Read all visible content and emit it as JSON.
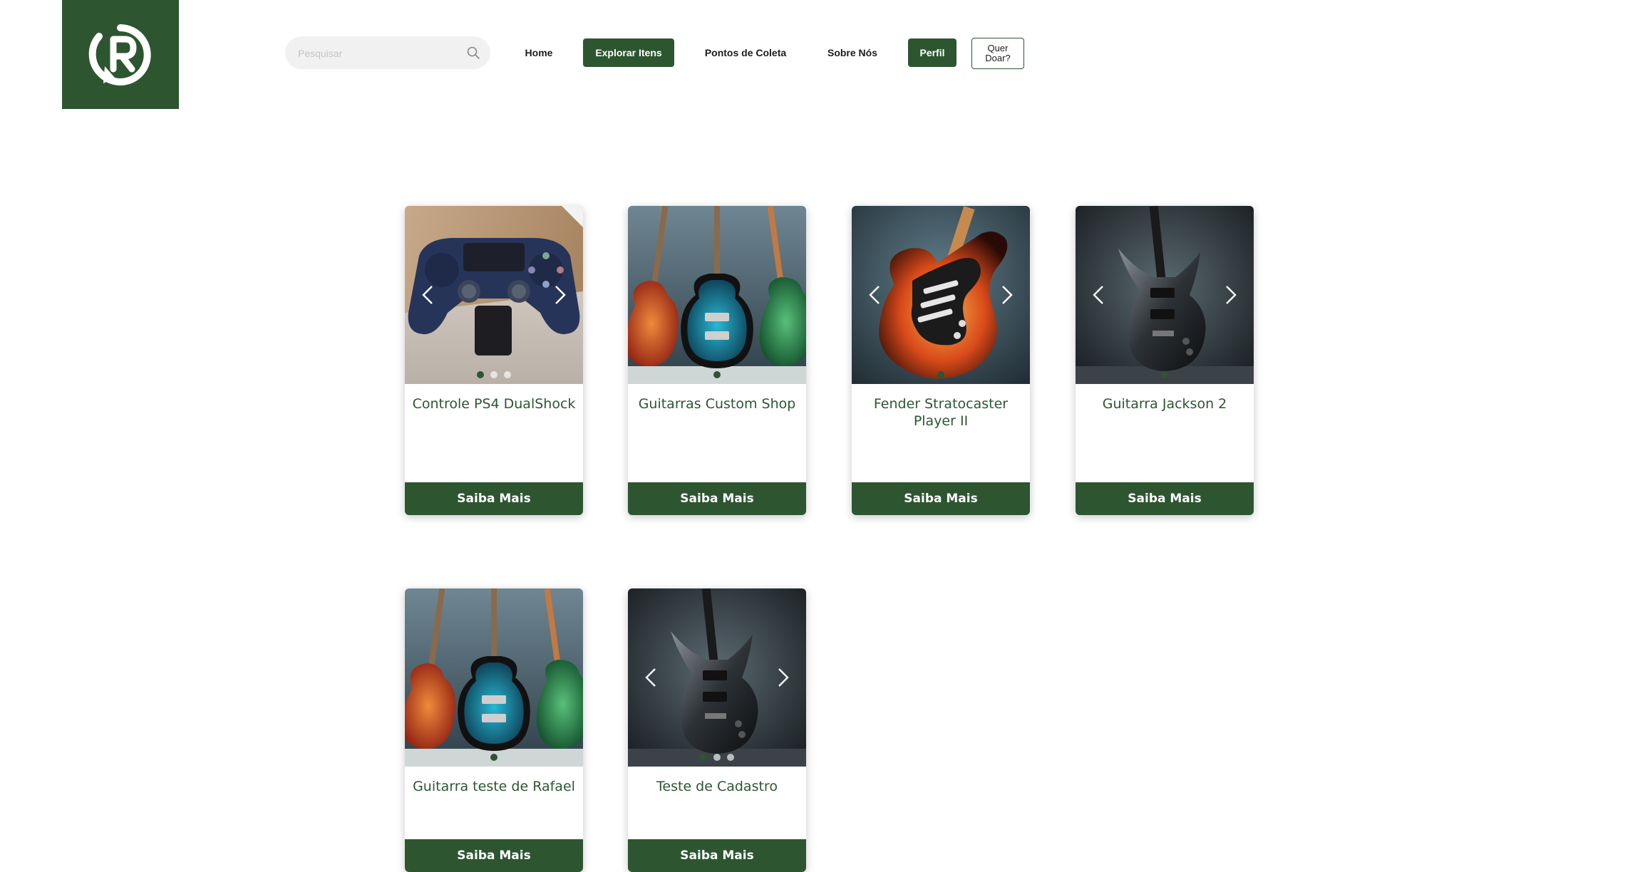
{
  "header": {
    "search": {
      "placeholder": "Pesquisar",
      "value": ""
    },
    "nav": {
      "home": "Home",
      "explore": "Explorar Itens",
      "points": "Pontos de Coleta",
      "about": "Sobre Nós",
      "profile": "Perfil",
      "donate_line1": "Quer",
      "donate_line2": "Doar?"
    }
  },
  "colors": {
    "brand": "#2d5630",
    "brand_text": "#2d5630",
    "search_bg": "#f1f1f1"
  },
  "items": [
    {
      "title": "Controle PS4 DualShock",
      "button": "Saiba Mais",
      "image": "ps4-controller-photo",
      "dots": 3,
      "active_dot": 0,
      "arrows": true
    },
    {
      "title": "Guitarras Custom Shop",
      "button": "Saiba Mais",
      "image": "three-guitars-photo",
      "dots": 1,
      "active_dot": 0,
      "arrows": false
    },
    {
      "title": "Fender Stratocaster Player II",
      "button": "Saiba Mais",
      "image": "sunburst-stratocaster-photo",
      "dots": 1,
      "active_dot": 0,
      "arrows": true
    },
    {
      "title": "Guitarra Jackson 2",
      "button": "Saiba Mais",
      "image": "black-jackson-guitar-photo",
      "dots": 1,
      "active_dot": 0,
      "arrows": true
    },
    {
      "title": "Guitarra teste de Rafael",
      "button": "Saiba Mais",
      "image": "three-guitars-photo",
      "dots": 1,
      "active_dot": 0,
      "arrows": false
    },
    {
      "title": "Teste de Cadastro",
      "button": "Saiba Mais",
      "image": "black-jackson-guitar-photo",
      "dots": 3,
      "active_dot": 0,
      "arrows": true
    }
  ]
}
